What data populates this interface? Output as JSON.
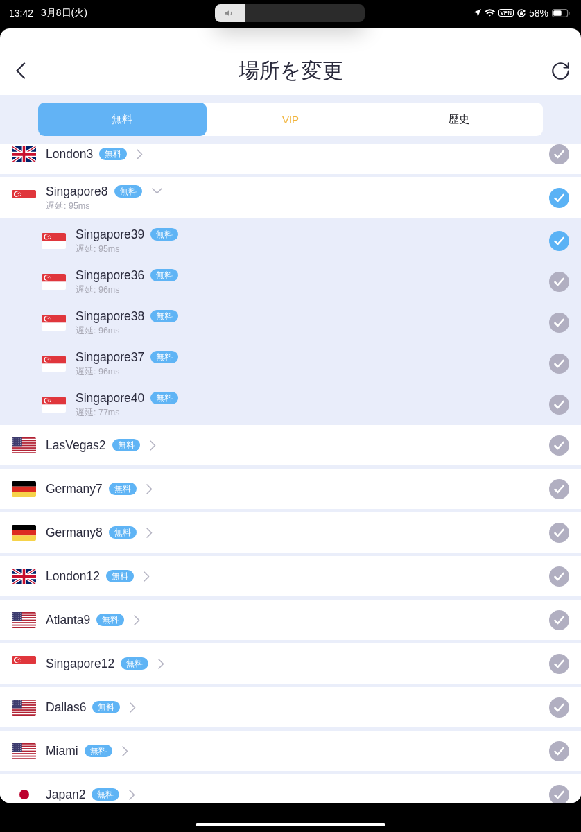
{
  "status_bar": {
    "time": "13:42",
    "date": "3月8日(火)",
    "vpn": "VPN",
    "battery": "58%"
  },
  "volume": {
    "level": 0.2
  },
  "header": {
    "title": "場所を変更"
  },
  "tabs": [
    {
      "label": "無料",
      "selected": true,
      "kind": "standard"
    },
    {
      "label": "VIP",
      "selected": false,
      "kind": "premium"
    },
    {
      "label": "歴史",
      "selected": false,
      "kind": "standard"
    }
  ],
  "servers": [
    {
      "name": "London3",
      "kind": "uk",
      "badge": "無料",
      "expanded": false,
      "selected": false
    },
    {
      "name": "Singapore8",
      "kind": "singapore",
      "badge": "無料",
      "latency": "遅延: 95ms",
      "expanded": true,
      "selected": true,
      "children": [
        {
          "name": "Singapore39",
          "kind": "singapore",
          "badge": "無料",
          "latency": "遅延: 95ms",
          "selected": true
        },
        {
          "name": "Singapore36",
          "kind": "singapore",
          "badge": "無料",
          "latency": "遅延: 96ms",
          "selected": false
        },
        {
          "name": "Singapore38",
          "kind": "singapore",
          "badge": "無料",
          "latency": "遅延: 96ms",
          "selected": false
        },
        {
          "name": "Singapore37",
          "kind": "singapore",
          "badge": "無料",
          "latency": "遅延: 96ms",
          "selected": false
        },
        {
          "name": "Singapore40",
          "kind": "singapore",
          "badge": "無料",
          "latency": "遅延: 77ms",
          "selected": false
        }
      ]
    },
    {
      "name": "LasVegas2",
      "kind": "us",
      "badge": "無料",
      "expanded": false,
      "selected": false
    },
    {
      "name": "Germany7",
      "kind": "germany",
      "badge": "無料",
      "expanded": false,
      "selected": false
    },
    {
      "name": "Germany8",
      "kind": "germany",
      "badge": "無料",
      "expanded": false,
      "selected": false
    },
    {
      "name": "London12",
      "kind": "uk",
      "badge": "無料",
      "expanded": false,
      "selected": false
    },
    {
      "name": "Atlanta9",
      "kind": "us",
      "badge": "無料",
      "expanded": false,
      "selected": false
    },
    {
      "name": "Singapore12",
      "kind": "singapore",
      "badge": "無料",
      "expanded": false,
      "selected": false
    },
    {
      "name": "Dallas6",
      "kind": "us",
      "badge": "無料",
      "expanded": false,
      "selected": false
    },
    {
      "name": "Miami",
      "kind": "us",
      "badge": "無料",
      "expanded": false,
      "selected": false
    },
    {
      "name": "Japan2",
      "kind": "japan",
      "badge": "無料",
      "expanded": false,
      "selected": false
    }
  ]
}
